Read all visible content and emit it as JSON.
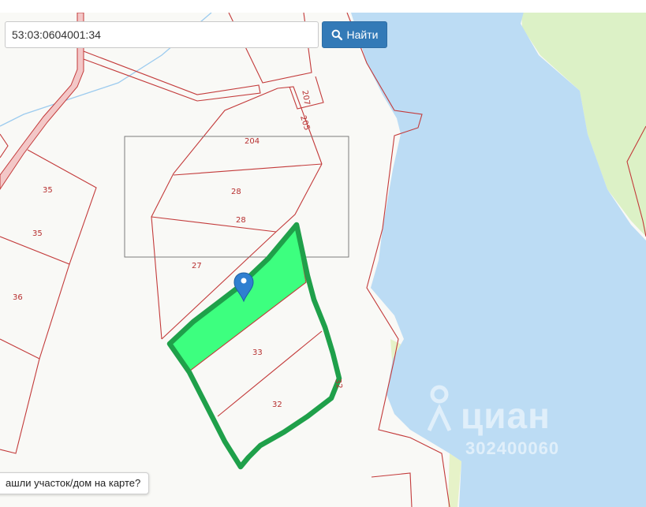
{
  "search": {
    "query": "53:03:0604001:34",
    "button_label": "Найти"
  },
  "hint": {
    "text": "ашли участок/дом на карте?"
  },
  "watermark": {
    "brand": "циан",
    "listing_id": "302400060"
  },
  "map": {
    "parcel_labels": [
      "204",
      "207",
      "205",
      "28",
      "28",
      "27",
      "35",
      "35",
      "36",
      "33",
      "32",
      "32"
    ],
    "colors": {
      "land": "#f9f9f6",
      "water": "#bcdcf4",
      "forest": "#dcf1c6",
      "parcel_border": "#c33a3a",
      "selection_outline": "#1fa04a",
      "selection_fill": "#3dff7f",
      "marker": "#2f7fd0",
      "road": "#f3c7c7",
      "search_button": "#337ab7"
    },
    "icons": [
      "search-icon",
      "map-marker-icon",
      "cian-logo-icon"
    ]
  }
}
